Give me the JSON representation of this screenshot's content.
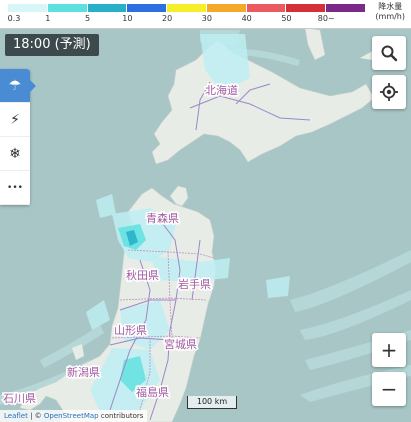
{
  "legend": {
    "colors": [
      "#d9f6f7",
      "#5ee0e0",
      "#27b0c8",
      "#2d6ee0",
      "#f5ef2a",
      "#f3a92a",
      "#ea5a5f",
      "#d4303a",
      "#7b2a8a"
    ],
    "ticks": [
      "0.3",
      "1",
      "5",
      "10",
      "20",
      "30",
      "40",
      "50",
      "80~"
    ],
    "unit_line1": "降水量",
    "unit_line2": "(mm/h)"
  },
  "time_label": "18:00 (予測)",
  "side_menu": [
    {
      "name": "rain-cloud-icon",
      "glyph": "☂",
      "active": true
    },
    {
      "name": "lightning-icon",
      "glyph": "⚡",
      "active": false
    },
    {
      "name": "snow-icon",
      "glyph": "❄",
      "active": false
    },
    {
      "name": "more-icon",
      "glyph": "•••",
      "active": false
    }
  ],
  "prefectures": [
    {
      "id": "hokkaido",
      "label": "北海道"
    },
    {
      "id": "aomori",
      "label": "青森県"
    },
    {
      "id": "akita",
      "label": "秋田県"
    },
    {
      "id": "iwate",
      "label": "岩手県"
    },
    {
      "id": "yamagata",
      "label": "山形県"
    },
    {
      "id": "miyagi",
      "label": "宮城県"
    },
    {
      "id": "niigata",
      "label": "新潟県"
    },
    {
      "id": "fukushima",
      "label": "福島県"
    },
    {
      "id": "ishikawa",
      "label": "石川県"
    }
  ],
  "controls": {
    "zoom_in": "+",
    "zoom_out": "−",
    "search_icon": "search-icon",
    "locate_icon": "locate-icon"
  },
  "scale_label": "100 km",
  "attribution": {
    "leaflet": "Leaflet",
    "separator": " | © ",
    "osm": "OpenStreetMap",
    "suffix": " contributors"
  }
}
